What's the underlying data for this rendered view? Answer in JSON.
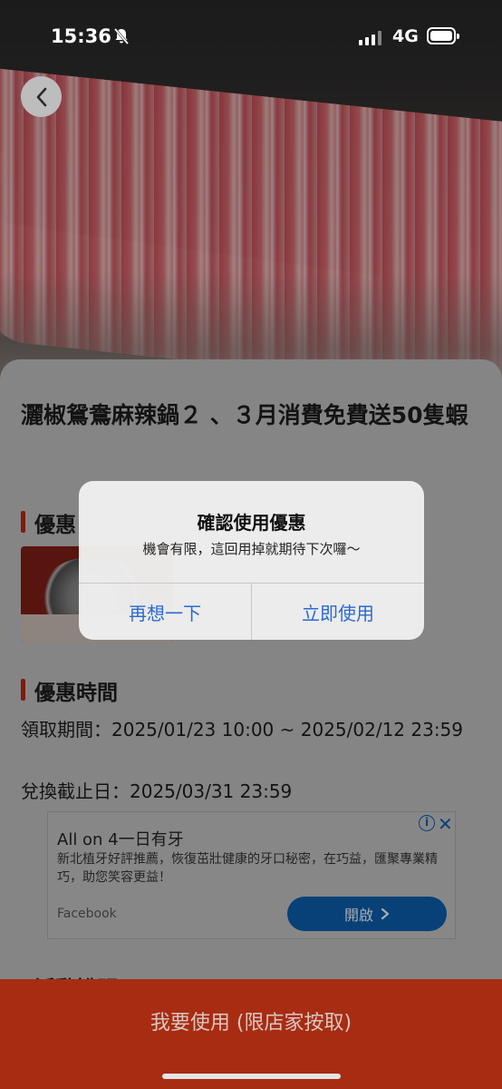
{
  "status_bar": {
    "time": "15:36",
    "network": "4G",
    "icons": [
      "bell-slash-icon",
      "signal-icon",
      "battery-icon"
    ]
  },
  "nav": {
    "back_icon": "chevron-left-icon"
  },
  "offer": {
    "title": "灑椒鴛鴦麻辣鍋２ 、３月消費免費送50隻蝦",
    "section_offer": "優惠",
    "section_time": "優惠時間",
    "claim_period": "領取期間：2025/01/23 10:00 ~ 2025/02/12 23:59",
    "redeem_deadline": "兌換截止日：2025/03/31 23:59",
    "section_activity": "活動說明"
  },
  "ad": {
    "title": "All on 4一日有牙",
    "description": "新北植牙好評推薦，恢復茁壯健康的牙口秘密，在巧益，匯聚專業精巧，助您笑容更益！",
    "source": "Facebook",
    "cta": "開啟",
    "cta_icon": "chevron-right-icon",
    "info_icon": "info-icon",
    "close_icon": "close-icon"
  },
  "cta": {
    "label": "我要使用 (限店家按取)"
  },
  "dialog": {
    "title": "確認使用優惠",
    "message": "機會有限，這回用掉就期待下次囉～",
    "cancel": "再想一下",
    "confirm": "立即使用"
  },
  "colors": {
    "accent": "#d63a1a",
    "dialog_button": "#2a6ad1",
    "ad_button": "#1877f2"
  }
}
